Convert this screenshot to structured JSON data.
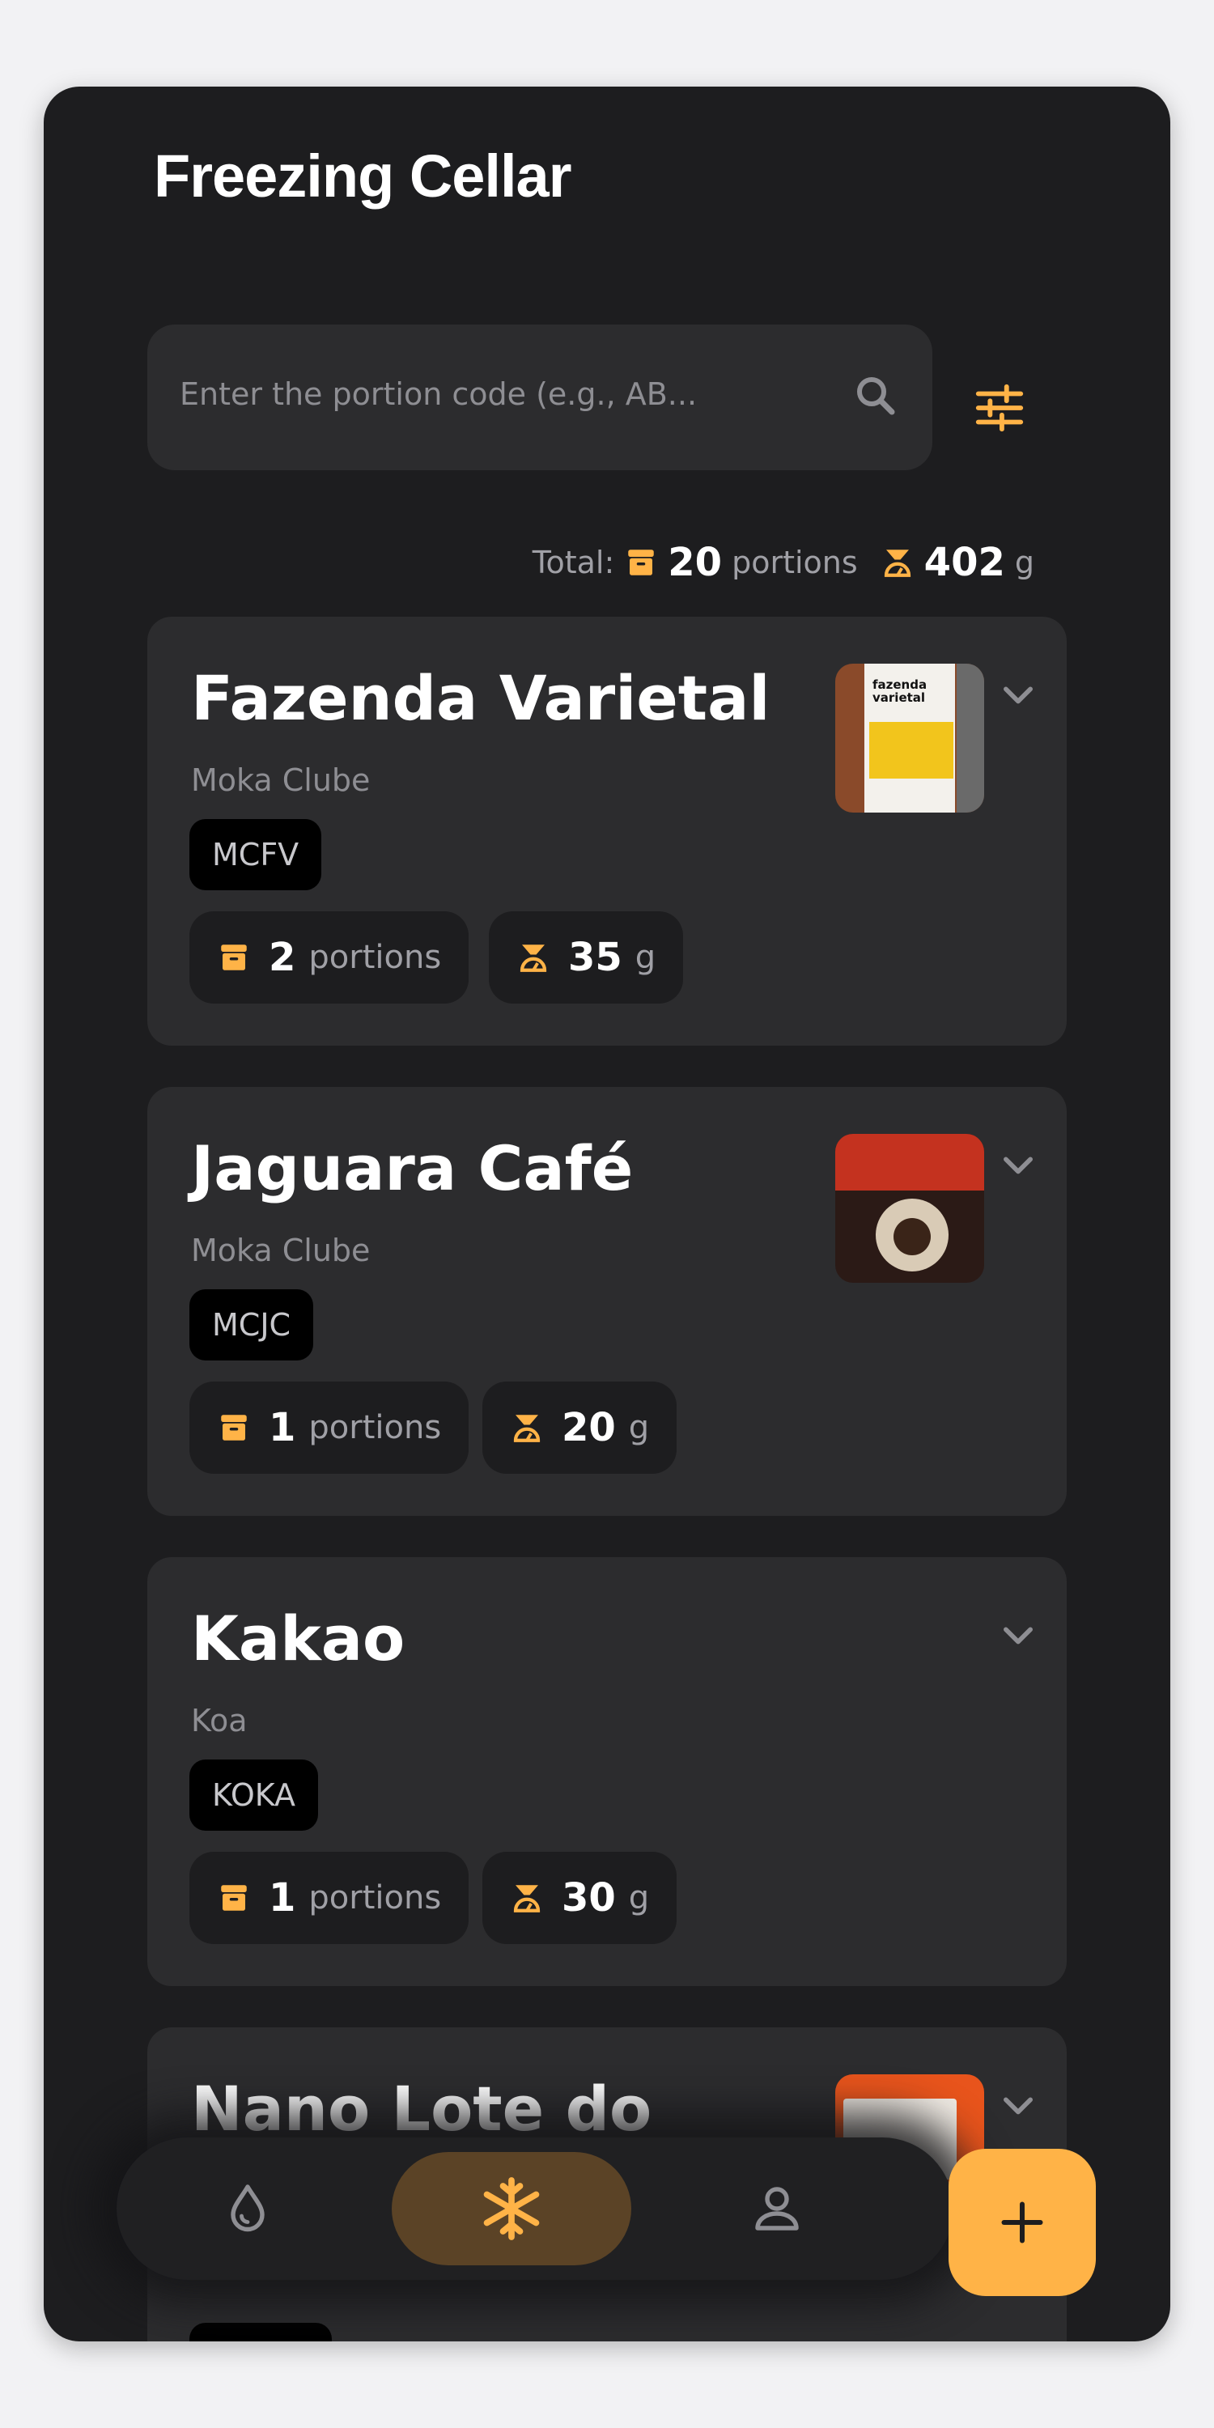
{
  "header": {
    "title": "Freezing Cellar"
  },
  "search": {
    "placeholder": "Enter the portion code (e.g., AB..."
  },
  "totals": {
    "label": "Total:",
    "portions": "20",
    "portions_unit": "portions",
    "grams": "402",
    "grams_unit": "g"
  },
  "cards": [
    {
      "name": "Fazenda Varietal",
      "roaster": "Moka Clube",
      "code": "MCFV",
      "portions": "2",
      "portions_unit": "portions",
      "grams": "35",
      "grams_unit": "g",
      "thumb_title": "fazenda varietal"
    },
    {
      "name": "Jaguara Café",
      "roaster": "Moka Clube",
      "code": "MCJC",
      "portions": "1",
      "portions_unit": "portions",
      "grams": "20",
      "grams_unit": "g"
    },
    {
      "name": "Kakao",
      "roaster": "Koa",
      "code": "KOKA",
      "portions": "1",
      "portions_unit": "portions",
      "grams": "30",
      "grams_unit": "g"
    },
    {
      "name": "Nano Lote do"
    }
  ],
  "colors": {
    "accent": "#ffb347",
    "background": "#1d1d1f",
    "card": "#2c2c2e"
  },
  "nav": {
    "items": [
      "drop-icon",
      "snowflake-icon",
      "person-icon"
    ],
    "active": "snowflake-icon"
  },
  "fab": {
    "icon": "plus-icon"
  }
}
